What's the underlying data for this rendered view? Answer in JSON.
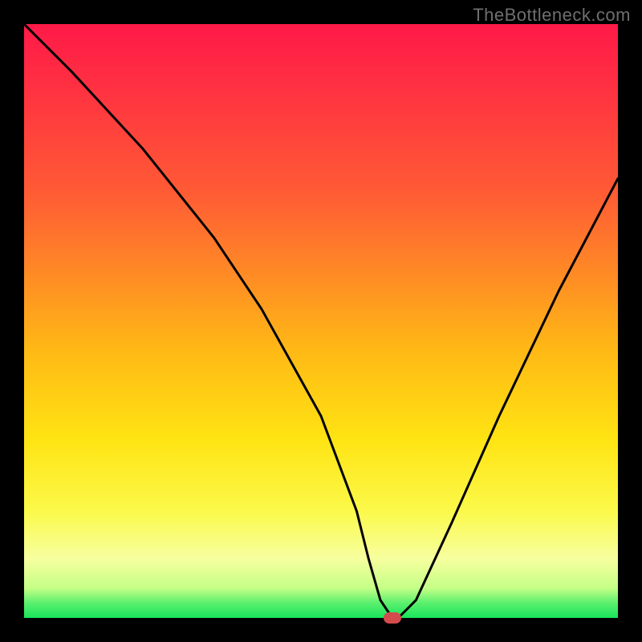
{
  "watermark": "TheBottleneck.com",
  "marker_color": "#d34b4d",
  "chart_data": {
    "type": "line",
    "title": "",
    "xlabel": "",
    "ylabel": "",
    "xlim": [
      0,
      100
    ],
    "ylim": [
      0,
      100
    ],
    "x": [
      0,
      8,
      20,
      32,
      40,
      50,
      56,
      58,
      60,
      62,
      63,
      66,
      72,
      80,
      90,
      100
    ],
    "values": [
      100,
      92,
      79,
      64,
      52,
      34,
      18,
      10,
      3,
      0,
      0,
      3,
      16,
      34,
      55,
      74
    ],
    "minimum_marker": {
      "x": 62,
      "y": 0
    }
  }
}
